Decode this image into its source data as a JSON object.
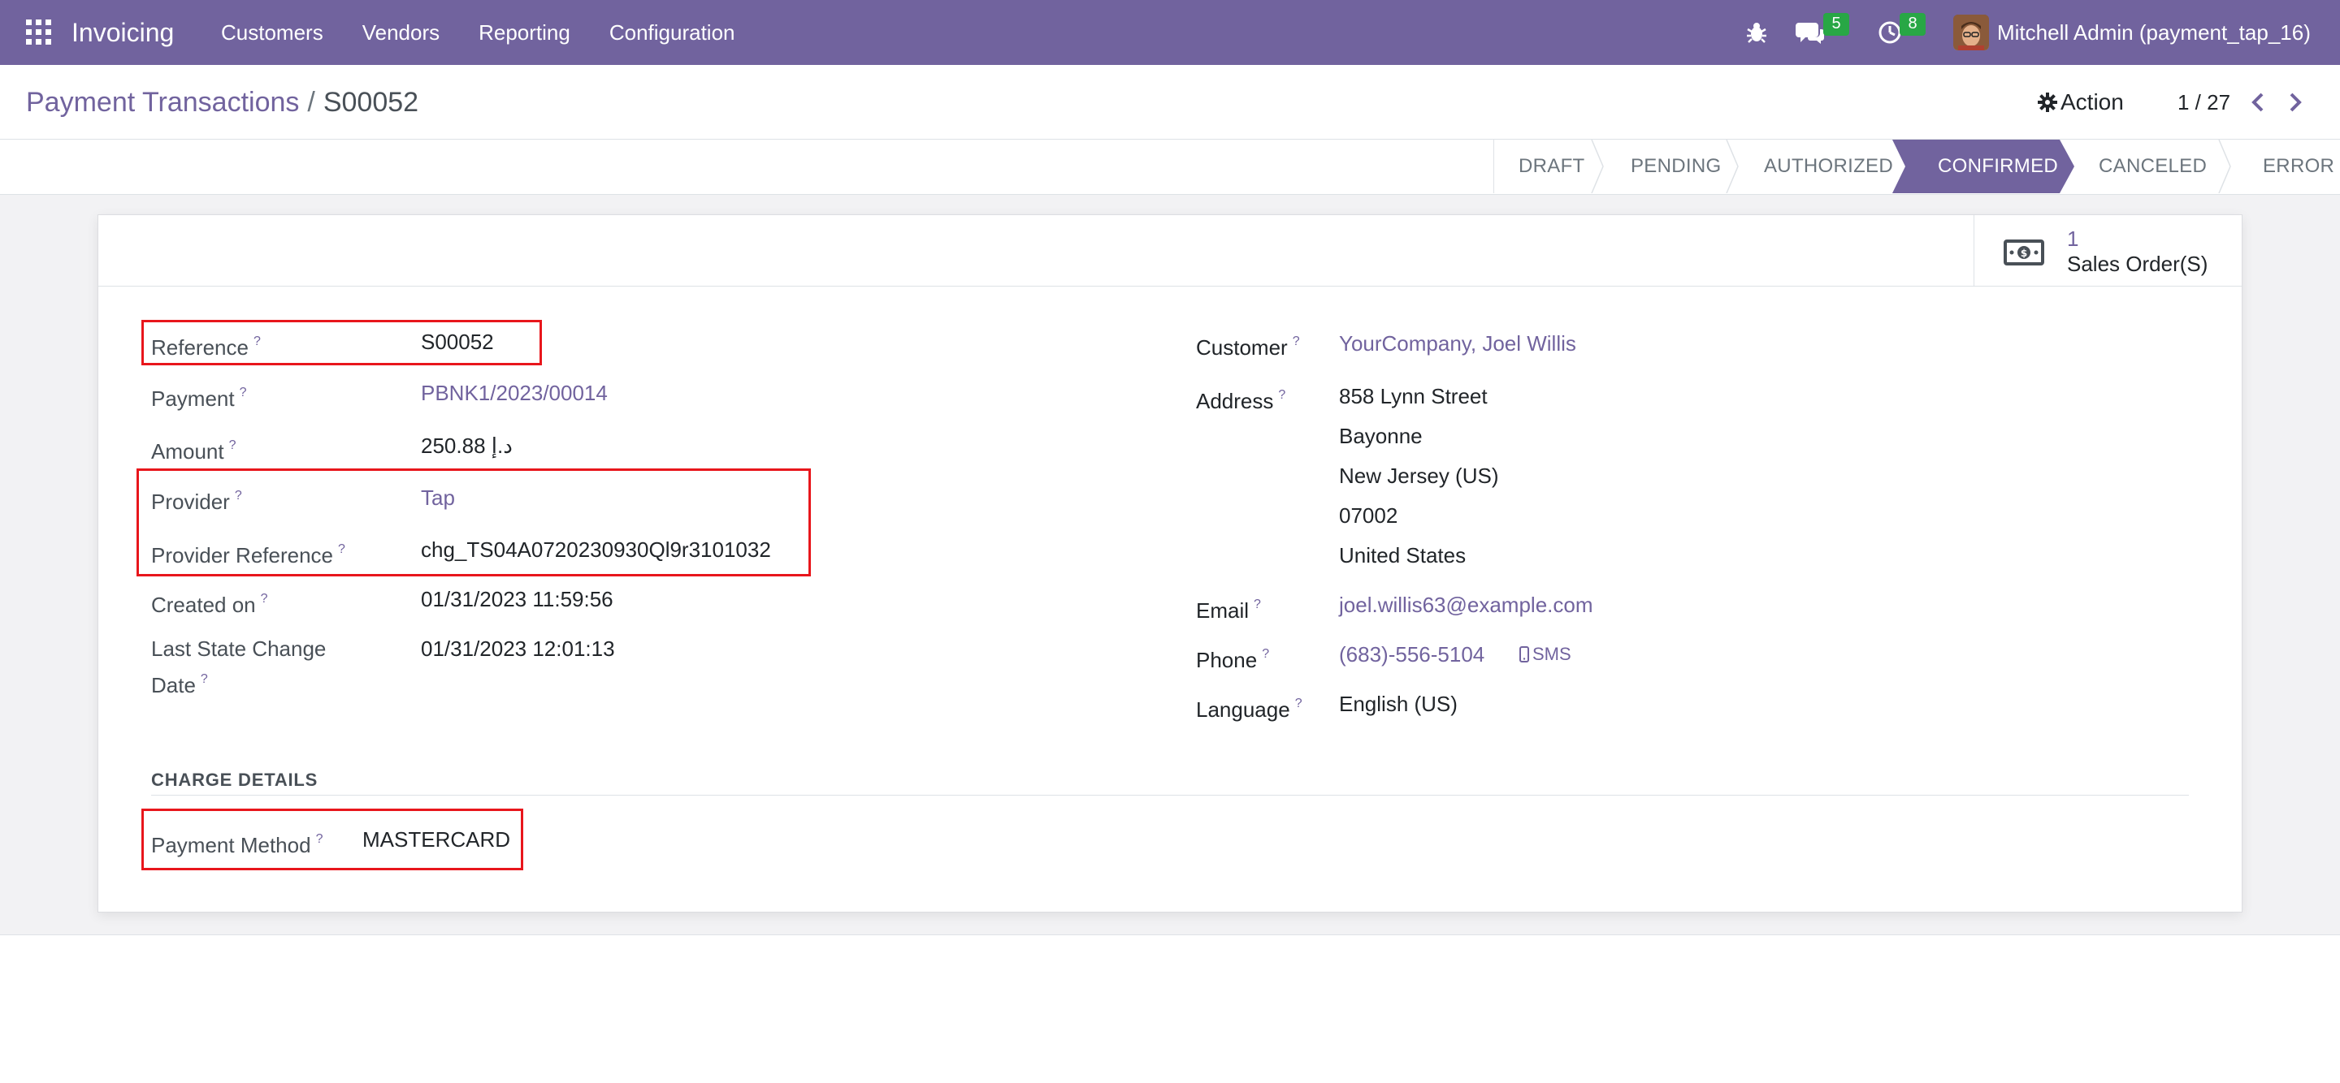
{
  "navbar": {
    "brand": "Invoicing",
    "menu": [
      "Customers",
      "Vendors",
      "Reporting",
      "Configuration"
    ],
    "messages_count": "5",
    "activities_count": "8",
    "user": "Mitchell Admin (payment_tap_16)"
  },
  "breadcrumb": {
    "parent": "Payment Transactions",
    "separator": "/",
    "current": "S00052"
  },
  "control": {
    "action_label": "Action",
    "pager": "1 / 27"
  },
  "statusbar": {
    "stages": [
      "DRAFT",
      "PENDING",
      "AUTHORIZED",
      "CONFIRMED",
      "CANCELED",
      "ERROR"
    ],
    "active": "CONFIRMED"
  },
  "smart_button": {
    "count": "1",
    "label": "Sales Order(S)"
  },
  "left_fields": {
    "reference": {
      "label": "Reference",
      "value": "S00052"
    },
    "payment": {
      "label": "Payment",
      "value": "PBNK1/2023/00014"
    },
    "amount": {
      "label": "Amount",
      "value": "250.88 د.إ"
    },
    "provider": {
      "label": "Provider",
      "value": "Tap"
    },
    "provider_reference": {
      "label": "Provider Reference",
      "value": "chg_TS04A0720230930Ql9r3101032"
    },
    "created_on": {
      "label": "Created on",
      "value": "01/31/2023 11:59:56"
    },
    "last_state_change": {
      "label_line1": "Last State Change",
      "label_line2": "Date",
      "value": "01/31/2023 12:01:13"
    }
  },
  "right_fields": {
    "customer": {
      "label": "Customer",
      "value": "YourCompany, Joel Willis"
    },
    "address": {
      "label": "Address",
      "lines": [
        "858 Lynn Street",
        "Bayonne",
        "New Jersey (US)",
        "07002",
        "United States"
      ]
    },
    "email": {
      "label": "Email",
      "value": "joel.willis63@example.com"
    },
    "phone": {
      "label": "Phone",
      "value": "(683)-556-5104",
      "sms_label": "SMS"
    },
    "language": {
      "label": "Language",
      "value": "English (US)"
    }
  },
  "charge_details": {
    "title": "CHARGE DETAILS",
    "payment_method": {
      "label": "Payment Method",
      "value": "MASTERCARD"
    }
  },
  "colors": {
    "brand": "#71639e",
    "badge_green": "#28a745",
    "highlight_red": "#e8161c"
  },
  "icons": {
    "apps": "apps-grid-icon",
    "debug": "bug-icon",
    "messages": "chat-icon",
    "activities": "clock-icon",
    "action": "gear-icon",
    "pager_prev": "chevron-left-icon",
    "pager_next": "chevron-right-icon",
    "smart_button": "money-icon",
    "sms": "mobile-icon"
  }
}
